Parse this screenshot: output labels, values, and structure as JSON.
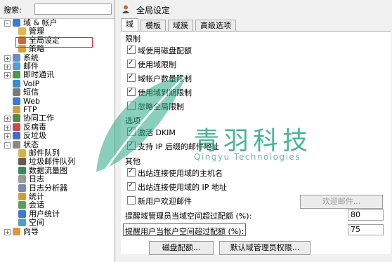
{
  "search": {
    "label": "搜索:",
    "value": ""
  },
  "tree": [
    {
      "label": "域 & 帐户",
      "expander": "-",
      "icon": "globe-icon",
      "color": "#3a7bd5"
    },
    {
      "label": "管理",
      "icon": "folder-icon",
      "color": "#e5b64a"
    },
    {
      "label": "全局设定",
      "icon": "user-settings-icon",
      "color": "#c86a3a"
    },
    {
      "label": "策略",
      "icon": "policy-icon",
      "color": "#d9a23a"
    },
    {
      "label": "系统",
      "expander": "+",
      "icon": "system-icon",
      "color": "#6a8fc8"
    },
    {
      "label": "邮件",
      "expander": "+",
      "icon": "mail-icon",
      "color": "#5a9ad8"
    },
    {
      "label": "即时通讯",
      "expander": "+",
      "icon": "chat-icon",
      "color": "#4a9a4a"
    },
    {
      "label": "VoIP",
      "icon": "voip-icon",
      "color": "#3a8ad0"
    },
    {
      "label": "短信",
      "icon": "sms-icon",
      "color": "#7a7a7a"
    },
    {
      "label": "Web",
      "icon": "web-icon",
      "color": "#3a7bd5"
    },
    {
      "label": "FTP",
      "icon": "ftp-icon",
      "color": "#c8a04a"
    },
    {
      "label": "协同工作",
      "expander": "+",
      "icon": "groupware-icon",
      "color": "#5a8a3a"
    },
    {
      "label": "反病毒",
      "expander": "+",
      "icon": "antivirus-icon",
      "color": "#c84a4a"
    },
    {
      "label": "反垃圾",
      "expander": "+",
      "icon": "antispam-icon",
      "color": "#4a6ac8"
    },
    {
      "label": "状态",
      "expander": "-",
      "icon": "status-icon",
      "color": "#8a8a8a"
    },
    {
      "label": "邮件队列",
      "icon": "queue-icon",
      "color": "#d8b04a"
    },
    {
      "label": "垃圾邮件队列",
      "icon": "spam-queue-icon",
      "color": "#6a5a4a"
    },
    {
      "label": "数据流量图",
      "icon": "traffic-chart-icon",
      "color": "#3a8a5a"
    },
    {
      "label": "日志",
      "icon": "log-icon",
      "color": "#9a9a9a"
    },
    {
      "label": "日志分析器",
      "icon": "log-analyzer-icon",
      "color": "#7a8ab0"
    },
    {
      "label": "统计",
      "icon": "stats-icon",
      "color": "#c8a03a"
    },
    {
      "label": "会话",
      "icon": "session-icon",
      "color": "#5aa05a"
    },
    {
      "label": "用户统计",
      "icon": "user-stats-icon",
      "color": "#3a7bd5"
    },
    {
      "label": "空间",
      "icon": "space-icon",
      "color": "#4aa0c8"
    },
    {
      "label": "向导",
      "expander": "+",
      "icon": "wizard-icon",
      "color": "#d89a3a"
    }
  ],
  "header": {
    "title": "全局设定"
  },
  "tabs": [
    {
      "label": "域"
    },
    {
      "label": "模板"
    },
    {
      "label": "域簇"
    },
    {
      "label": "高级选项"
    }
  ],
  "sections": {
    "limits": "限制",
    "options": "选项",
    "other": "其他"
  },
  "limits": [
    {
      "label": "域使用磁盘配额",
      "checked": true
    },
    {
      "label": "使用域限制",
      "checked": true
    },
    {
      "label": "域帐户数量限制",
      "checked": true
    },
    {
      "label": "使用域到期限制",
      "checked": true
    },
    {
      "label": "忽略全局限制",
      "checked": false
    }
  ],
  "options": [
    {
      "label": "激活 DKIM",
      "checked": true
    },
    {
      "label": "支持 IP 后缀的邮件地址",
      "checked": true
    }
  ],
  "other": [
    {
      "label": "出站连接使用域的主机名",
      "checked": true
    },
    {
      "label": "出站连接使用域的 IP 地址",
      "checked": true
    },
    {
      "label": "新用户欢迎邮件",
      "checked": false
    }
  ],
  "welcome_button": "欢迎邮件...",
  "admin_quota_label": "提醒域管理员当域空间超过配额 (%):",
  "admin_quota_value": "80",
  "user_quota_label": "提醒用户当帐户空间超过配额 (%):",
  "user_quota_value": "75",
  "disk_quota_button": "磁盘配额...",
  "default_admin_rights_button": "默认域管理员权限...",
  "watermark": {
    "text": "青羽科技",
    "sub": "Qingyu Technologies"
  }
}
